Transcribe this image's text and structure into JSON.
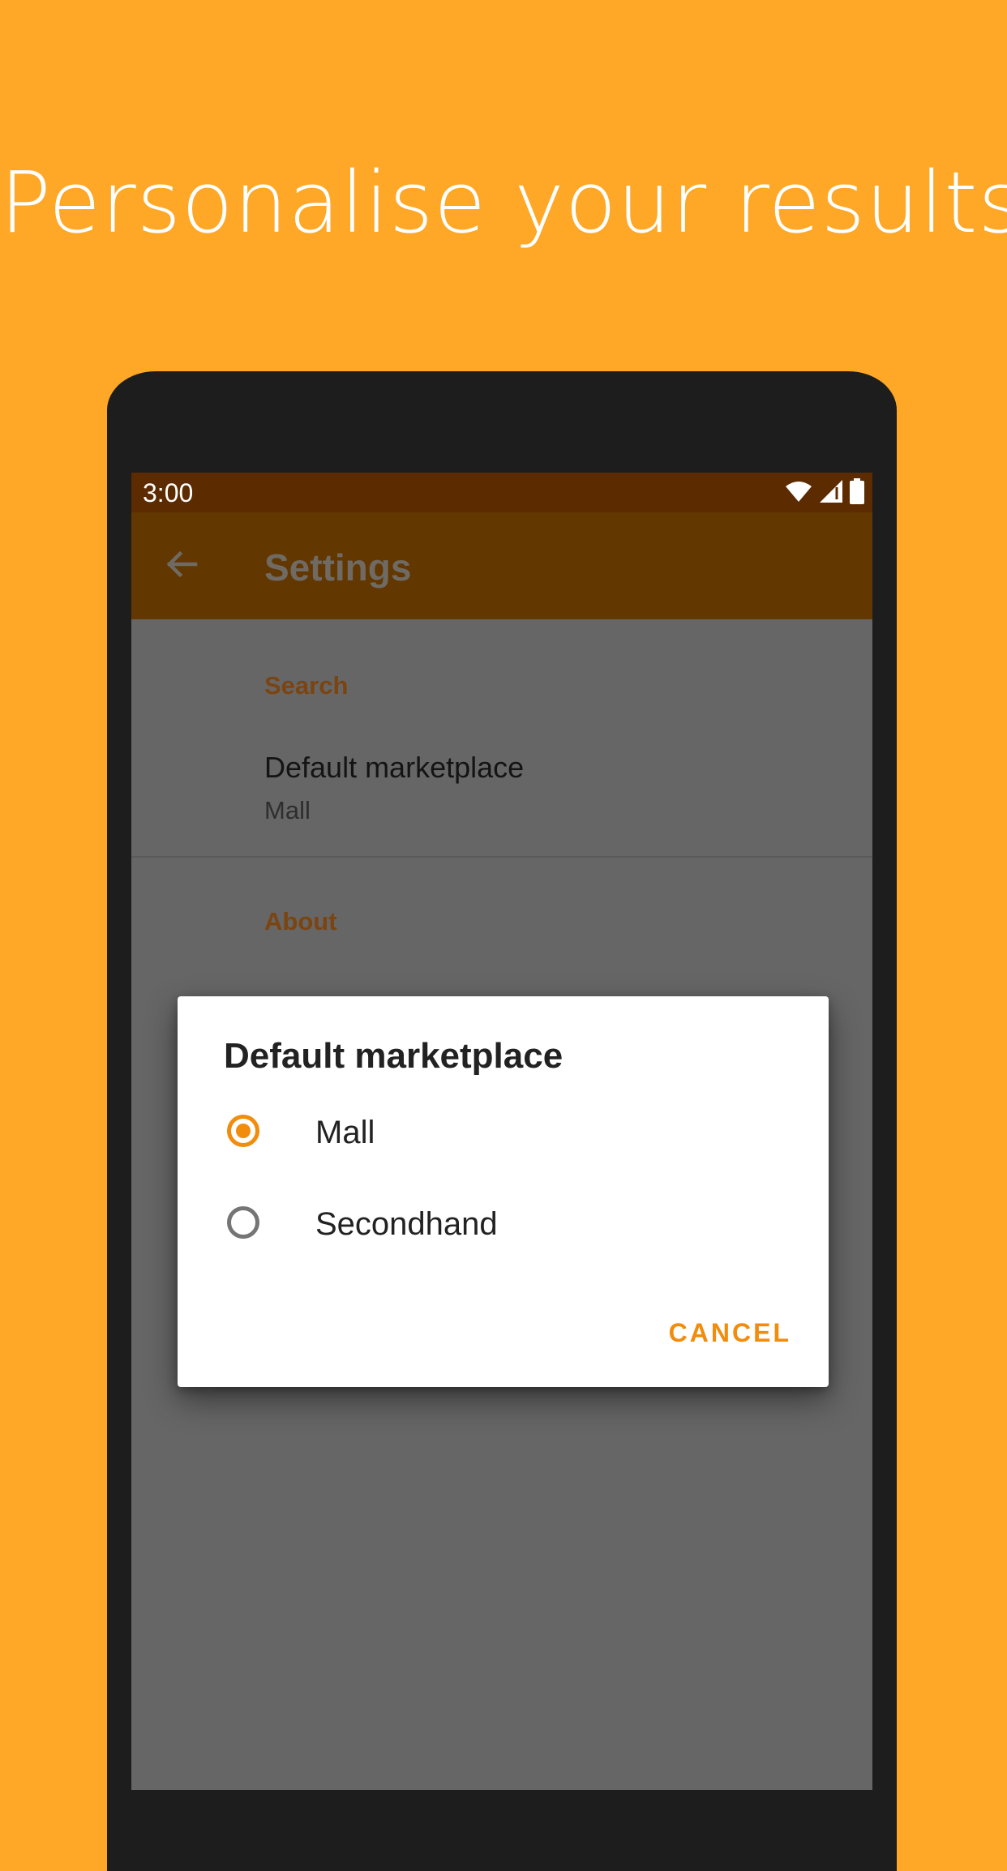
{
  "headline": "Personalise your results",
  "status_bar": {
    "time": "3:00",
    "icons": [
      "wifi-icon",
      "signal-icon",
      "battery-icon"
    ]
  },
  "app_bar": {
    "title": "Settings",
    "back_icon": "arrow-back-icon"
  },
  "settings": {
    "section_search": "Search",
    "default_marketplace_title": "Default marketplace",
    "default_marketplace_summary": "Mall",
    "section_about": "About"
  },
  "dialog": {
    "title": "Default marketplace",
    "options": [
      {
        "label": "Mall",
        "selected": true
      },
      {
        "label": "Secondhand",
        "selected": false
      }
    ],
    "cancel_label": "CANCEL"
  },
  "colors": {
    "background": "#FFA726",
    "accent": "#F28C0D",
    "app_bar": "#633700",
    "status_bar": "#5c2b00",
    "scrim_content": "#666666"
  }
}
